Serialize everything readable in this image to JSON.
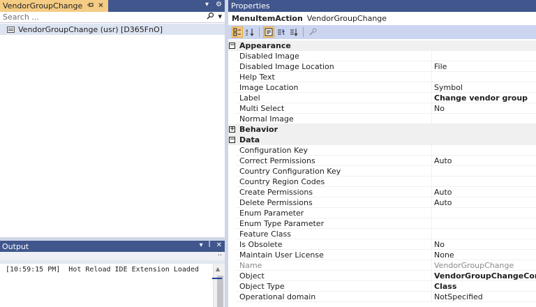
{
  "left_pane": {
    "tab_label": "VendorGroupChange",
    "tab_pin_icon": "pin-icon",
    "tab_close_glyph": "✕",
    "toolbar_glyphs": [
      "▾",
      "⚙"
    ],
    "search_placeholder": "Search ...",
    "search_icon_glyph": "⚲",
    "search_dropdown_glyph": "▾",
    "tree_item_label": "VendorGroupChange (usr) [D365FnO]"
  },
  "output_pane": {
    "title": "Output",
    "title_glyphs": [
      "▾",
      "ꟾ",
      "✕"
    ],
    "more_glyph": "⁚⁚",
    "line": "[10:59:15 PM]  Hot Reload IDE Extension Loaded",
    "scroll_up_glyph": "▲"
  },
  "properties_pane": {
    "title": "Properties",
    "object_type": "MenuItemAction",
    "object_name": "VendorGroupChange",
    "toolbar": {
      "categorized_glyph": "▦",
      "alphabetical_glyph": "↓",
      "properties_glyph": "▤",
      "events_glyph": "⇊",
      "sort_glyph": "⇅",
      "property_pages_glyph": "🔧"
    },
    "rows": [
      {
        "kind": "category",
        "expander": "−",
        "name": "Appearance",
        "value": ""
      },
      {
        "kind": "prop",
        "name": "Disabled Image",
        "value": ""
      },
      {
        "kind": "prop",
        "name": "Disabled Image Location",
        "value": "File"
      },
      {
        "kind": "prop",
        "name": "Help Text",
        "value": ""
      },
      {
        "kind": "prop",
        "name": "Image Location",
        "value": "Symbol"
      },
      {
        "kind": "prop",
        "name": "Label",
        "value": "Change vendor group",
        "bold": true
      },
      {
        "kind": "prop",
        "name": "Multi Select",
        "value": "No"
      },
      {
        "kind": "prop",
        "name": "Normal Image",
        "value": ""
      },
      {
        "kind": "category",
        "expander": "+",
        "name": "Behavior",
        "value": ""
      },
      {
        "kind": "category",
        "expander": "−",
        "name": "Data",
        "value": ""
      },
      {
        "kind": "prop",
        "name": "Configuration Key",
        "value": ""
      },
      {
        "kind": "prop",
        "name": "Correct Permissions",
        "value": "Auto"
      },
      {
        "kind": "prop",
        "name": "Country Configuration Key",
        "value": ""
      },
      {
        "kind": "prop",
        "name": "Country Region Codes",
        "value": ""
      },
      {
        "kind": "prop",
        "name": "Create Permissions",
        "value": "Auto"
      },
      {
        "kind": "prop",
        "name": "Delete Permissions",
        "value": "Auto"
      },
      {
        "kind": "prop",
        "name": "Enum Parameter",
        "value": ""
      },
      {
        "kind": "prop",
        "name": "Enum Type Parameter",
        "value": ""
      },
      {
        "kind": "prop",
        "name": "Feature Class",
        "value": ""
      },
      {
        "kind": "prop",
        "name": "Is Obsolete",
        "value": "No"
      },
      {
        "kind": "prop",
        "name": "Maintain User License",
        "value": "None"
      },
      {
        "kind": "prop",
        "name": "Name",
        "value": "VendorGroupChange",
        "grey": true
      },
      {
        "kind": "prop",
        "name": "Object",
        "value": "VendorGroupChangeController",
        "bold": true
      },
      {
        "kind": "prop",
        "name": "Object Type",
        "value": "Class",
        "bold": true
      },
      {
        "kind": "prop",
        "name": "Operational domain",
        "value": "NotSpecified"
      }
    ]
  },
  "colors": {
    "titlebar": "#40568d",
    "active_tab": "#f5cc84",
    "toolbar_bg": "#ccd5f0",
    "selection": "#dde4f1"
  }
}
